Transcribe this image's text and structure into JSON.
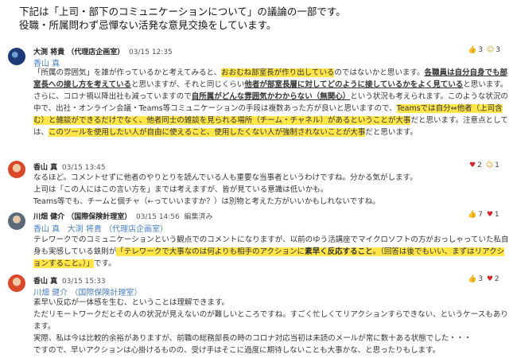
{
  "header": {
    "line1": "下記は「上司・部下のコミュニケーションについて」の議論の一部です。",
    "line2": "役職・所属問わず忌憚ない活発な意見交換をしています。"
  },
  "posts": [
    {
      "author": "大渕 将貴 （代理店企画室）",
      "time": "03/15 12:35",
      "mention": "香山 真",
      "reactions": {
        "like": "3",
        "smile": "3"
      },
      "segments": [
        {
          "t": "「所属の雰囲気」を誰が作っているかと考えてみると、",
          "s": ""
        },
        {
          "t": "おおむね部室長が作り出している",
          "s": "hl"
        },
        {
          "t": "のではないかと思います。",
          "s": ""
        },
        {
          "t": "各職員は自分自身でも部室長への接し方を考えている",
          "s": "ul"
        },
        {
          "t": "と思いますが、それと同じくらい",
          "s": ""
        },
        {
          "t": "他者が部室長層に対してどのように接しているかをよく見ている",
          "s": "ul"
        },
        {
          "t": "と思います。さらに、コロナ禍以降出社も減っていますので",
          "s": ""
        },
        {
          "t": "自所属がどんな雰囲気かわからない（無関心）",
          "s": "ul"
        },
        {
          "t": "という状況も考えられます。",
          "s": ""
        },
        {
          "t": "このような状況の中で、出社・オンライン会議・Teams等コミュニケーションの手段は複数あった方が良いと思いますので、",
          "s": ""
        },
        {
          "t": "Teamsでは自分⇔他者（上司含む）と雑談ができるだけでなく、他者同士の雑談を見られる場所（チーム・チャネル）があるということが大事",
          "s": "hl"
        },
        {
          "t": "だと思います。注意点としては、",
          "s": ""
        },
        {
          "t": "このツールを使用したい人が自由に使えること、使用したくない人が強制されないことが大事",
          "s": "hl"
        },
        {
          "t": "だと思います。",
          "s": ""
        }
      ]
    },
    {
      "author": "香山 真",
      "time": "03/15 13:45",
      "reactions": {
        "heart": "2",
        "smile": "1"
      },
      "lines": [
        "なるほど。コメントせずに他者のやりとりを読んでいる人も重要な当事者というわけですね。分かる気がします。",
        "上司は「この人にはこの言い方を」までは考えますが、皆が見ている意識は低いかも。",
        "Teams等でも、チームと個チャ（←っていいますか？）は別物と考えた方がいいかもしれないですね。"
      ]
    },
    {
      "author": "川畑 健介 （国際保険計理室）",
      "time": "03/15 14:56",
      "edited": "編集済み",
      "mentions": [
        "香山 真",
        "大渕 将貴 （代理店企画室）"
      ],
      "reactions": {
        "like": "7",
        "heart": "1"
      },
      "segments": [
        {
          "t": "テレワークでのコミュニケーションという観点でのコメントになりますが、以前のゆう活講座でマイクロソフトの方がおっしゃっていた私自身も実感している鉄則が",
          "s": ""
        },
        {
          "t": "「テレワークで大事なのは何よりも相手のアクションに",
          "s": "hl"
        },
        {
          "t": "素早く反応すること",
          "s": "hlb"
        },
        {
          "t": "。（回答は後でもいい、まずはリアクションすること。）」",
          "s": "hl"
        },
        {
          "t": "です。",
          "s": ""
        }
      ]
    },
    {
      "author": "香山 真",
      "time": "03/15 15:33",
      "mention": "川畑 健介 （国際保険計理室）",
      "reactions": {
        "like": "3",
        "heart": "2"
      },
      "lines": [
        "素早い反応が一体感を生む、ということは理解できます。",
        "ただリモートワークだとその人の状況が見えないのが難しいところですね。すごく忙しくてリアクションすらできない、というケースもあります。",
        "実際、私は今は比較的余裕がありますが、前職の総務部長の時のコロナ対応当初は未読のメールが常に数十ある状態でした・・・",
        "ですので、早いアクションは心掛けるものの、受け手はそこに過度に期待しないことも大事かな、と思ったりもします。"
      ]
    }
  ]
}
